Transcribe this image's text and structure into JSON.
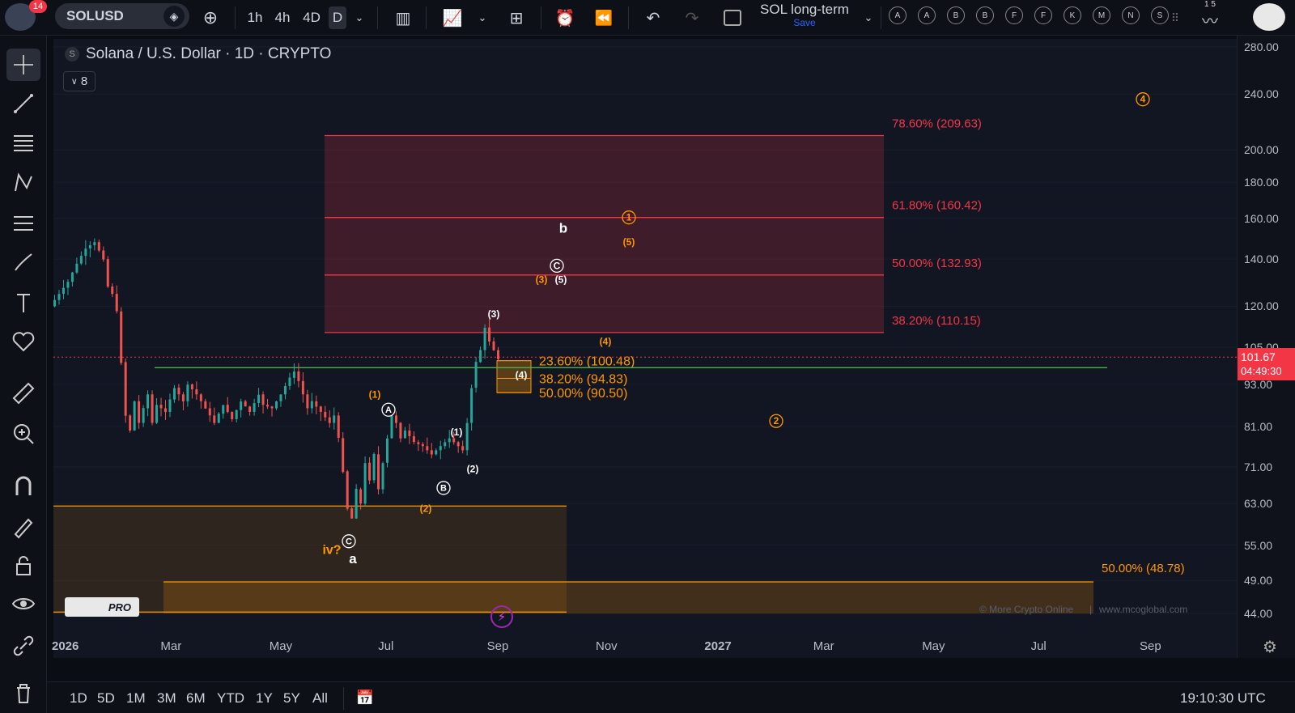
{
  "header": {
    "notification_count": "14",
    "symbol": "SOLUSD",
    "intervals": [
      "1h",
      "4h",
      "4D",
      "D"
    ],
    "layout_name": "SOL long-term",
    "save_label": "Save",
    "drawing_letters": [
      "A",
      "A",
      "B",
      "B",
      "F",
      "F",
      "K",
      "M",
      "N",
      "S"
    ],
    "corner_numbers": "1 5"
  },
  "chart": {
    "title": "Solana / U.S. Dollar · 1D · CRYPTO",
    "source_badge": "S",
    "indicator_count": "8",
    "watermark": "© More Crypto Online",
    "watermark_url": "www.mcoglobal.com",
    "logo_text": "PRO",
    "current_price": "101.67",
    "countdown": "04:49:30"
  },
  "chart_data": {
    "type": "candlestick",
    "symbol": "SOLUSD",
    "timeframe": "1D",
    "y_ticks": [
      280,
      240,
      200,
      180,
      160,
      140,
      120,
      105,
      93,
      81,
      71,
      63,
      55,
      49,
      44
    ],
    "y_tick_labels": [
      "280.00",
      "240.00",
      "200.00",
      "180.00",
      "160.00",
      "140.00",
      "120.00",
      "105.00",
      "93.00",
      "81.00",
      "71.00",
      "63.00",
      "55.00",
      "49.00",
      "44.00"
    ],
    "x_ticks": [
      "2026",
      "Mar",
      "May",
      "Jul",
      "Sep",
      "Nov",
      "2027",
      "Mar",
      "May",
      "Jul",
      "Sep"
    ],
    "price_path": [
      [
        0,
        120
      ],
      [
        2,
        125
      ],
      [
        4,
        130
      ],
      [
        6,
        138
      ],
      [
        8,
        145
      ],
      [
        10,
        148
      ],
      [
        12,
        140
      ],
      [
        13,
        128
      ],
      [
        14,
        125
      ],
      [
        15,
        118
      ],
      [
        16,
        100
      ],
      [
        17,
        84
      ],
      [
        18,
        80
      ],
      [
        19,
        88
      ],
      [
        20,
        82
      ],
      [
        22,
        90
      ],
      [
        23,
        82
      ],
      [
        24,
        87
      ],
      [
        26,
        85
      ],
      [
        28,
        92
      ],
      [
        30,
        88
      ],
      [
        31,
        93
      ],
      [
        33,
        90
      ],
      [
        35,
        86
      ],
      [
        37,
        82
      ],
      [
        39,
        87
      ],
      [
        41,
        83
      ],
      [
        43,
        88
      ],
      [
        45,
        85
      ],
      [
        47,
        90
      ],
      [
        48,
        87
      ],
      [
        50,
        86
      ],
      [
        52,
        90
      ],
      [
        54,
        95
      ],
      [
        55,
        97
      ],
      [
        56,
        94
      ],
      [
        57,
        90
      ],
      [
        58,
        86
      ],
      [
        59,
        88
      ],
      [
        61,
        85
      ],
      [
        63,
        82
      ],
      [
        64,
        84
      ],
      [
        65,
        78
      ],
      [
        66,
        70
      ],
      [
        67,
        62
      ],
      [
        68,
        60
      ],
      [
        69,
        66
      ],
      [
        70,
        63
      ],
      [
        71,
        72
      ],
      [
        72,
        68
      ],
      [
        73,
        74
      ],
      [
        74,
        66
      ],
      [
        75,
        72
      ],
      [
        76,
        78
      ],
      [
        77,
        84
      ],
      [
        78,
        82
      ],
      [
        79,
        78
      ],
      [
        80,
        80
      ],
      [
        82,
        77
      ],
      [
        84,
        76
      ],
      [
        86,
        74
      ],
      [
        88,
        76
      ],
      [
        90,
        78
      ],
      [
        92,
        76
      ],
      [
        93,
        75
      ],
      [
        94,
        82
      ],
      [
        95,
        92
      ],
      [
        96,
        100
      ],
      [
        97,
        104
      ],
      [
        98,
        112
      ],
      [
        99,
        107
      ],
      [
        100,
        104
      ],
      [
        101,
        101
      ]
    ],
    "fib_upper": [
      {
        "level": "78.60%",
        "price": 209.63
      },
      {
        "level": "61.80%",
        "price": 160.42
      },
      {
        "level": "50.00%",
        "price": 132.93
      },
      {
        "level": "38.20%",
        "price": 110.15
      }
    ],
    "fib_retrace": [
      {
        "level": "23.60%",
        "price": 100.48
      },
      {
        "level": "38.20%",
        "price": 94.83
      },
      {
        "level": "50.00%",
        "price": 90.5
      }
    ],
    "fib_lower": [
      {
        "level": "50.00%",
        "price": 48.78
      }
    ],
    "last_price": 101.67
  },
  "labels": {
    "fib_upper": [
      "78.60% (209.63)",
      "61.80% (160.42)",
      "50.00% (132.93)",
      "38.20% (110.15)"
    ],
    "fib_retrace": [
      "23.60% (100.48)",
      "38.20% (94.83)",
      "50.00% (90.50)"
    ],
    "fib_lower": "50.00% (48.78)",
    "waves": {
      "o1": "1",
      "o2": "2",
      "o4": "4",
      "p3": "(3)",
      "p5": "(5)",
      "p3b": "(3)",
      "p4": "(4)",
      "p4b": "(4)",
      "p1o": "(1)",
      "p2o": "(2)",
      "w1": "(1)",
      "w2": "(2)",
      "w3": "(3)",
      "w5": "(5)",
      "A": "A",
      "B": "B",
      "C": "C",
      "C2": "C",
      "b": "b",
      "a": "a",
      "iv": "iv?"
    }
  },
  "time_axis": {
    "ticks": [
      "2026",
      "Mar",
      "May",
      "Jul",
      "Sep",
      "Nov",
      "2027",
      "Mar",
      "May",
      "Jul",
      "Sep"
    ]
  },
  "bottom": {
    "ranges": [
      "1D",
      "5D",
      "1M",
      "3M",
      "6M",
      "YTD",
      "1Y",
      "5Y",
      "All"
    ],
    "clock": "19:10:30 UTC"
  },
  "colors": {
    "red": "#f23645",
    "orange": "#ff9800",
    "green": "#4caf50",
    "candle_up": "#26a69a",
    "candle_down": "#ef5350"
  }
}
